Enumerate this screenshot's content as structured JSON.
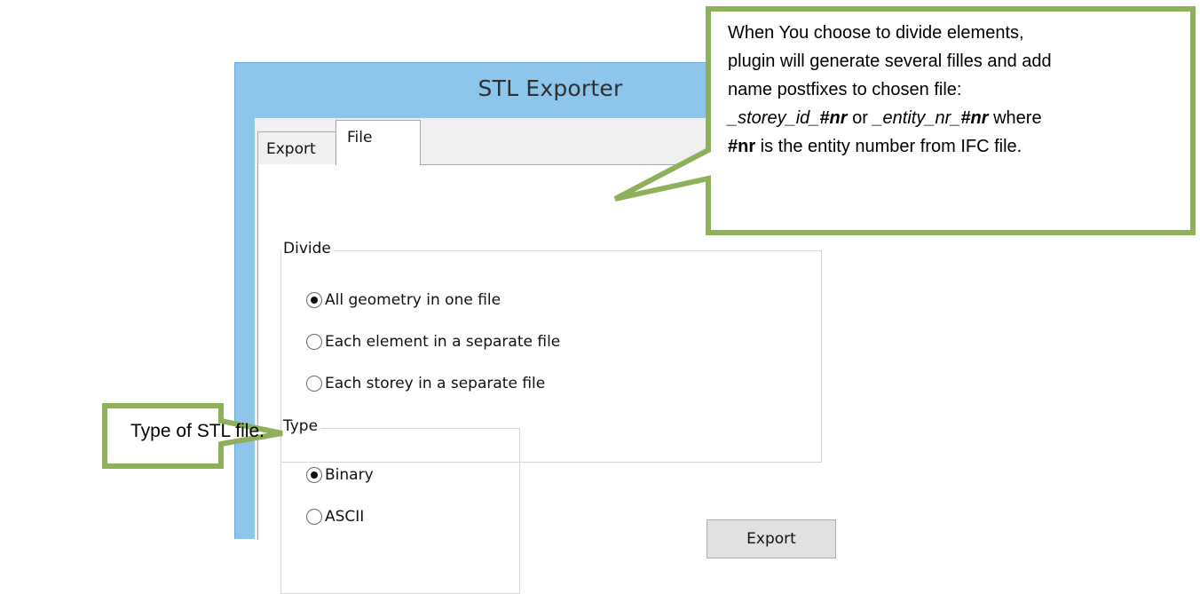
{
  "window": {
    "title": "STL Exporter"
  },
  "tabs": [
    {
      "label": "Export",
      "selected": false
    },
    {
      "label": "File",
      "selected": true
    }
  ],
  "divide_group": {
    "legend": "Divide",
    "options": [
      {
        "label": "All geometry in one file",
        "checked": true
      },
      {
        "label": "Each element in a separate file",
        "checked": false
      },
      {
        "label": "Each storey in a separate file",
        "checked": false
      }
    ]
  },
  "type_group": {
    "legend": "Type",
    "options": [
      {
        "label": "Binary",
        "checked": true
      },
      {
        "label": "ASCII",
        "checked": false
      }
    ]
  },
  "export_button": {
    "label": "Export"
  },
  "callouts": {
    "top": {
      "line1": "When You choose to divide elements,",
      "line2": "plugin will generate several filles and add",
      "line3": "name postfixes to chosen file:",
      "line4_part1": "_storey_id_",
      "line4_part2": "#nr",
      "line4_part3": " or ",
      "line4_part4": "_entity_nr_",
      "line4_part5": "#nr",
      "line4_part6": " where",
      "line5_part1": "#nr",
      "line5_part2": " is the entity number from IFC file."
    },
    "left": {
      "text": "Type of STL file."
    }
  },
  "colors": {
    "window_frame": "#8ec5ea",
    "callout_border": "#8fb05a"
  }
}
